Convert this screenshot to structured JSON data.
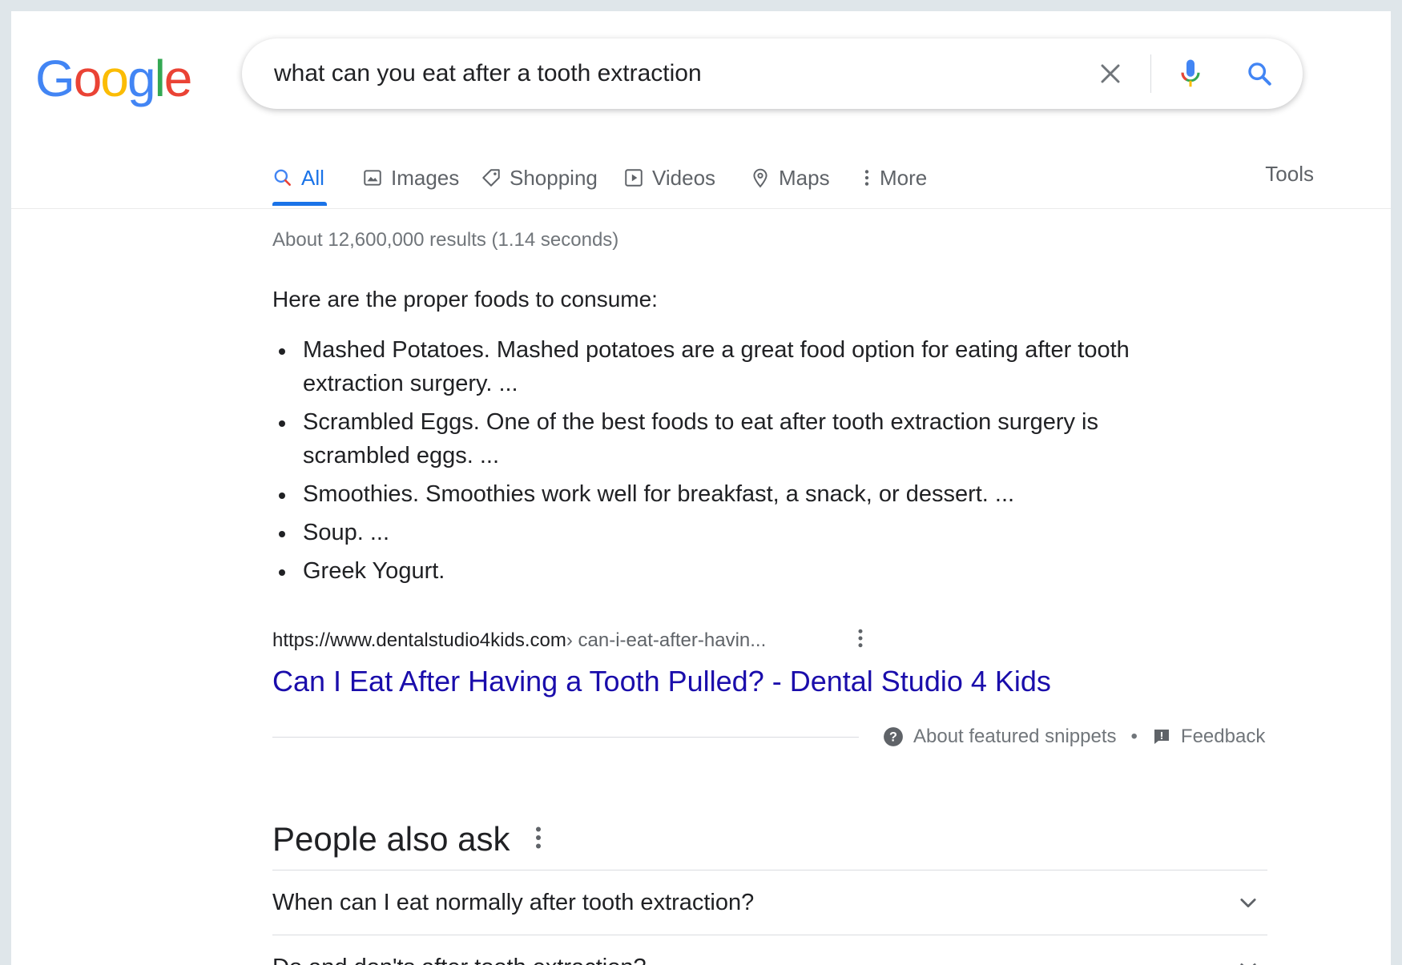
{
  "logo": {
    "letters": [
      {
        "ch": "G",
        "color": "#4285F4"
      },
      {
        "ch": "o",
        "color": "#EA4335"
      },
      {
        "ch": "o",
        "color": "#FBBC05"
      },
      {
        "ch": "g",
        "color": "#4285F4"
      },
      {
        "ch": "l",
        "color": "#34A853"
      },
      {
        "ch": "e",
        "color": "#EA4335"
      }
    ]
  },
  "search": {
    "query": "what can you eat after a tooth extraction",
    "clear_icon": "close-icon",
    "mic_icon": "microphone-icon",
    "search_icon": "magnifier-icon"
  },
  "tabs": [
    {
      "label": "All",
      "icon": "search-icon",
      "active": true
    },
    {
      "label": "Images",
      "icon": "image-icon",
      "active": false
    },
    {
      "label": "Shopping",
      "icon": "tag-icon",
      "active": false
    },
    {
      "label": "Videos",
      "icon": "play-icon",
      "active": false
    },
    {
      "label": "Maps",
      "icon": "map-pin-icon",
      "active": false
    },
    {
      "label": "More",
      "icon": "more-vertical-icon",
      "active": false
    }
  ],
  "tools_label": "Tools",
  "stats": "About 12,600,000 results (1.14 seconds)",
  "snippet": {
    "heading": "Here are the proper foods to consume:",
    "items": [
      "Mashed Potatoes. Mashed potatoes are a great food option for eating after tooth extraction surgery. ...",
      "Scrambled Eggs. One of the best foods to eat after tooth extraction surgery is scrambled eggs. ...",
      "Smoothies. Smoothies work well for breakfast, a snack, or dessert. ...",
      "Soup. ...",
      "Greek Yogurt."
    ],
    "cite_domain": "https://www.dentalstudio4kids.com",
    "cite_path": " › can-i-eat-after-havin...",
    "result_title": "Can I Eat After Having a Tooth Pulled? - Dental Studio 4 Kids",
    "about_label": "About featured snippets",
    "separator": "•",
    "feedback_label": "Feedback"
  },
  "paa": {
    "title": "People also ask",
    "questions": [
      "When can I eat normally after tooth extraction?",
      "Do and don'ts after tooth extraction?"
    ]
  },
  "colors": {
    "accent": "#1a73e8",
    "link": "#1a0dab"
  }
}
